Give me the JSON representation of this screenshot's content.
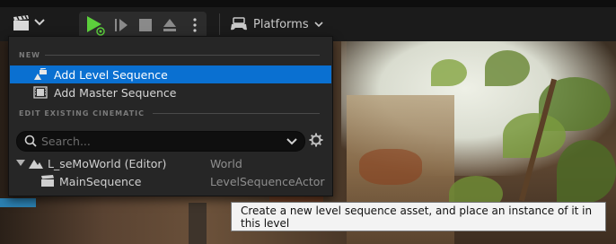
{
  "toolbar": {
    "platforms_label": "Platforms",
    "accent_play": "#5ccf3c"
  },
  "menu": {
    "section_new": "NEW",
    "items_new": [
      {
        "label": "Add Level Sequence",
        "icon": "level-sequence-icon",
        "selected": true
      },
      {
        "label": "Add Master Sequence",
        "icon": "master-sequence-icon",
        "selected": false
      }
    ],
    "section_edit": "EDIT EXISTING CINEMATIC",
    "search_placeholder": "Search...",
    "tree": [
      {
        "name": "L_seMoWorld (Editor)",
        "type": "World",
        "icon": "world-icon",
        "expanded": true
      },
      {
        "name": "MainSequence",
        "type": "LevelSequenceActor",
        "icon": "clapperboard-icon"
      }
    ],
    "selection_color": "#0a70d1"
  },
  "tooltip": {
    "text": "Create a new level sequence asset, and place an instance of it in this level"
  }
}
